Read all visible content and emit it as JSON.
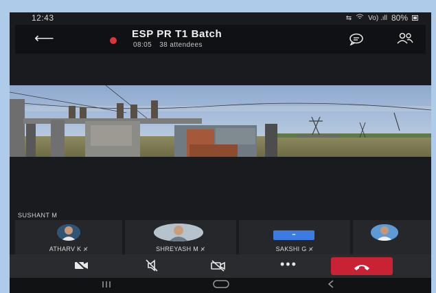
{
  "status_bar": {
    "time": "12:43",
    "signal": "Vo) .ıll",
    "battery": "80%"
  },
  "call": {
    "title": "ESP PR T1 Batch",
    "duration": "08:05",
    "attendees": "38 attendees"
  },
  "active_speaker": "SUSHANT M",
  "participants": [
    {
      "name": "ATHARV K"
    },
    {
      "name": "SHREYASH M"
    },
    {
      "name": "SAKSHI G"
    }
  ],
  "colors": {
    "recording": "#e0343a",
    "end_call": "#c92235",
    "sakshi_badge": "#3b7be3"
  },
  "icons": [
    "back-arrow-icon",
    "recording-dot-icon",
    "chat-icon",
    "people-icon",
    "mic-off-icon",
    "camera-icon",
    "mute-icon",
    "video-off-icon",
    "more-icon",
    "end-call-icon",
    "recents-icon",
    "home-icon",
    "back-icon"
  ]
}
